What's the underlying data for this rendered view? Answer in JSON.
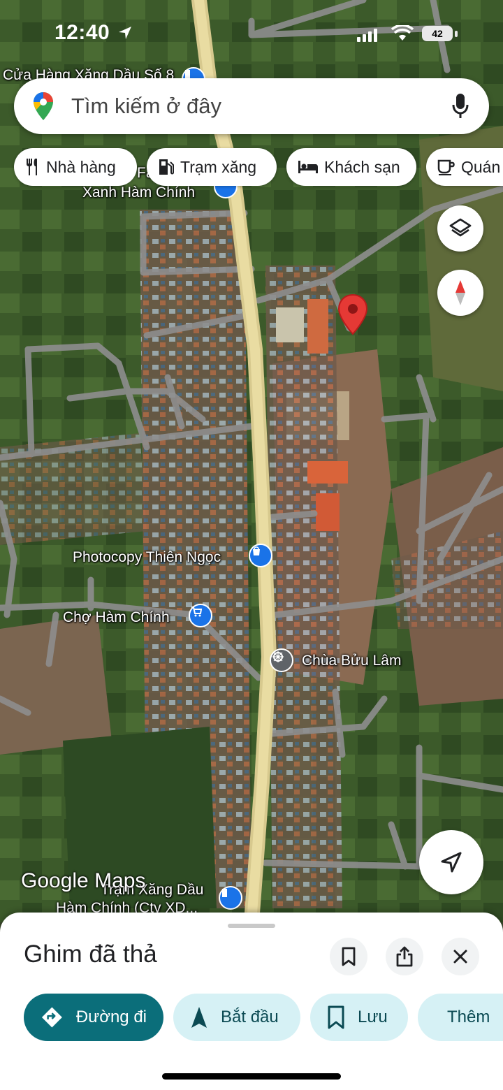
{
  "status_bar": {
    "time": "12:40",
    "battery": "42"
  },
  "search": {
    "placeholder": "Tìm kiếm ở đây"
  },
  "chips": [
    {
      "label": "Nhà hàng",
      "icon": "fork-knife-icon"
    },
    {
      "label": "Trạm xăng",
      "icon": "gas-station-icon"
    },
    {
      "label": "Khách sạn",
      "icon": "bed-icon"
    },
    {
      "label": "Quán",
      "icon": "coffee-icon"
    }
  ],
  "map": {
    "labels": {
      "gas_station_top": "Cửa Hàng Xăng Dầu Số 8",
      "top_partial": "Fa",
      "xanh_ham_chinh": "Xanh Hàm Chính",
      "photocopy": "Photocopy Thiên Ngọc",
      "cho": "Chợ Hàm Chính",
      "chua": "Chùa Bửu Lâm",
      "gas_station_bottom_1": "Trạm Xăng Dầu",
      "gas_station_bottom_2": "Hàm Chính (Cty XD..."
    },
    "watermark": "Google Maps",
    "colors": {
      "pin": "#e53935",
      "poi_blue": "#1a73e8",
      "poi_gray": "#5f6368"
    }
  },
  "sheet": {
    "title": "Ghim đã thả",
    "actions": [
      {
        "label": "Đường đi",
        "icon": "directions-icon"
      },
      {
        "label": "Bắt đầu",
        "icon": "navigation-arrow-icon"
      },
      {
        "label": "Lưu",
        "icon": "bookmark-icon"
      },
      {
        "label": "Thêm",
        "icon": "flag-icon"
      }
    ]
  }
}
